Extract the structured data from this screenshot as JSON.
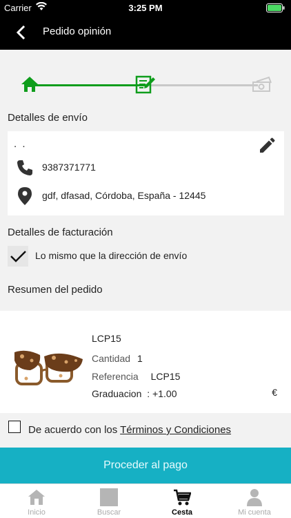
{
  "status": {
    "carrier": "Carrier",
    "time": "3:25 PM"
  },
  "nav": {
    "title": "Pedido opinión"
  },
  "colors": {
    "accent": "#0f9d1c",
    "proceed": "#16b0c4"
  },
  "shipping": {
    "heading": "Detalles de envío",
    "name": ". .",
    "phone": "9387371771",
    "address": "gdf, dfasad, Córdoba, España - 12445"
  },
  "billing": {
    "heading": "Detalles de facturación",
    "same_as_shipping": "Lo mismo que la dirección de envío"
  },
  "summary": {
    "heading": "Resumen del pedido"
  },
  "product": {
    "code": "LCP15",
    "quantity_label": "Cantidad",
    "quantity": "1",
    "reference_label": "Referencia",
    "reference": "LCP15",
    "graduation_label": "Graduacion",
    "graduation": ": +1.00",
    "currency": "€"
  },
  "terms": {
    "prefix": "De acuerdo con los ",
    "link": "Términos y Condiciones"
  },
  "proceed_label": "Proceder al pago",
  "tabs": [
    {
      "label": "Inicio",
      "icon": "home-icon"
    },
    {
      "label": "Buscar",
      "icon": "search-icon"
    },
    {
      "label": "Cesta",
      "icon": "cart-icon"
    },
    {
      "label": "Mi cuenta",
      "icon": "account-icon"
    }
  ]
}
